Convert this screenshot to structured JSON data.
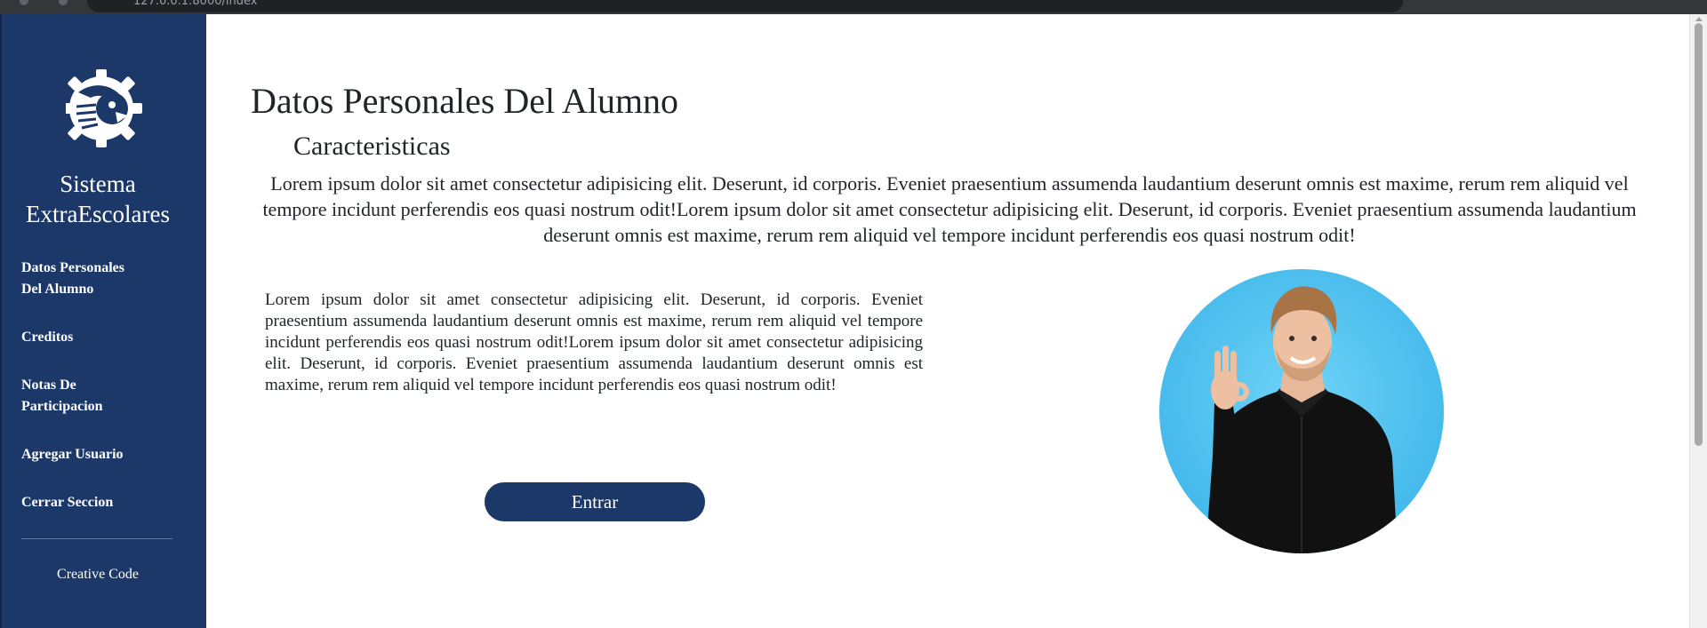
{
  "browser": {
    "url": "127.0.0.1:8000/index"
  },
  "sidebar": {
    "brand_line1": "Sistema",
    "brand_line2": "ExtraEscolares",
    "logo_icon": "eagle-gear-logo",
    "items": [
      {
        "line1": "Datos Personales",
        "line2": "Del Alumno"
      },
      {
        "line1": "Creditos",
        "line2": ""
      },
      {
        "line1": "Notas De",
        "line2": "Participacion"
      },
      {
        "line1": "Agregar Usuario",
        "line2": ""
      },
      {
        "line1": "Cerrar Seccion",
        "line2": ""
      }
    ],
    "footer": "Creative Code"
  },
  "main": {
    "title": "Datos Personales Del Alumno",
    "subtitle": "Caracteristicas",
    "intro": "Lorem ipsum dolor sit amet consectetur adipisicing elit. Deserunt, id corporis. Eveniet praesentium assumenda laudantium deserunt omnis est maxime, rerum rem aliquid vel tempore incidunt perferendis eos quasi nostrum odit!Lorem ipsum dolor sit amet consectetur adipisicing elit. Deserunt, id corporis. Eveniet praesentium assumenda laudantium deserunt omnis est maxime, rerum rem aliquid vel tempore incidunt perferendis eos quasi nostrum odit!",
    "body": "Lorem ipsum dolor sit amet consectetur adipisicing elit. Deserunt, id corporis. Eveniet praesentium assumenda laudantium deserunt omnis est maxime, rerum rem aliquid vel tempore incidunt perferendis eos quasi nostrum odit!Lorem ipsum dolor sit amet consectetur adipisicing elit. Deserunt, id corporis. Eveniet praesentium assumenda laudantium deserunt omnis est maxime, rerum rem aliquid vel tempore incidunt perferendis eos quasi nostrum odit!",
    "button_label": "Entrar",
    "photo_icon": "student-portrait"
  },
  "colors": {
    "sidebar": "#1b3869",
    "button": "#1b3869",
    "photo_background": "#4fc4f2",
    "text": "#212529"
  }
}
